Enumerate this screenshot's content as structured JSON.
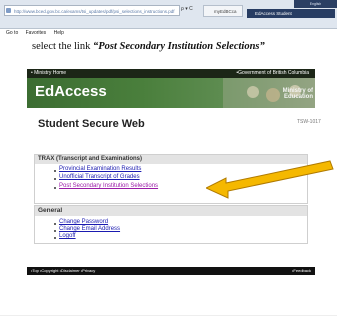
{
  "browser": {
    "address": "http://www.bced.gov.bc.ca/exams/tsi_updates/pdf/psi_selections_instructions.pdf",
    "address_tools": "ρ ▾ C",
    "tab_active": "myEdBCca",
    "tab_other": "EdAccess Student",
    "corner_text": "English",
    "menu": [
      "Go to",
      "Favorites",
      "Help"
    ]
  },
  "instruction": {
    "prefix": "select the link ",
    "link_text": "“Post Secondary Institution Selections”"
  },
  "site": {
    "top_left": "• Ministry Home",
    "top_right": "•Government of British Columbia",
    "brand": "EdAccess",
    "side_badge": "Ministry of Education",
    "page_title": "Student Secure Web",
    "page_code": "TSW-1017"
  },
  "trax": {
    "heading": "TRAX (Transcript and Examinations)",
    "links": [
      "Provincial Examination Results",
      "Unofficial Transcript of Grades",
      "Post Secondary Institution Selections"
    ]
  },
  "general": {
    "heading": "General",
    "links": [
      "Change Password",
      "Change Email Address",
      "Logoff"
    ]
  },
  "footer": {
    "left": "•Top  •Copyright  •Disclaimer  •Privacy",
    "right": "•Feedback"
  },
  "colors": {
    "header_green": "#4a7f3c",
    "arrow_fill": "#f5b800",
    "link_blue": "#1a1ab0",
    "highlight_link": "#9a1aa6"
  }
}
